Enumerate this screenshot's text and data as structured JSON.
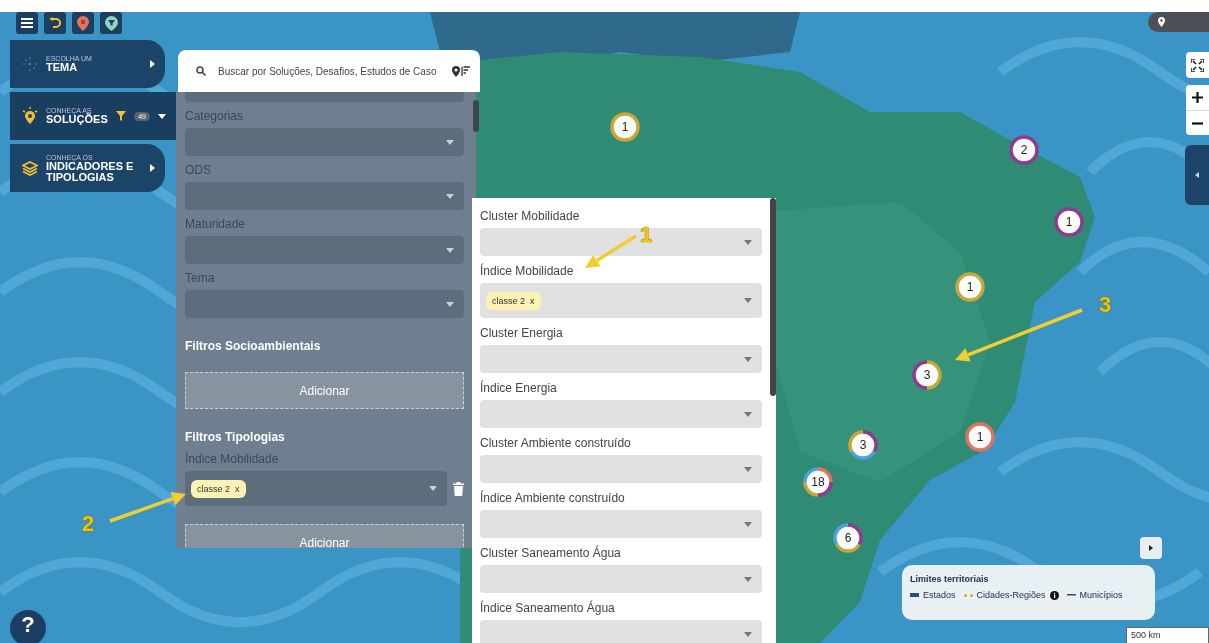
{
  "nav": [
    {
      "kicker": "ESCOLHA UM",
      "title": "TEMA",
      "selected": false
    },
    {
      "kicker": "CONHEÇA AS",
      "title": "SOLUÇÕES",
      "selected": true,
      "badge": "49"
    },
    {
      "kicker": "CONHEÇA OS",
      "title": "INDICADORES E TIPOLOGIAS",
      "selected": false
    }
  ],
  "search": {
    "placeholder": "Buscar por Soluções, Desafios, Estudos de Caso"
  },
  "filter_panel": {
    "fields": [
      {
        "kind": "stub"
      },
      {
        "kind": "select",
        "label": "Categorias"
      },
      {
        "kind": "select",
        "label": "ODS"
      },
      {
        "kind": "select",
        "label": "Maturidade"
      },
      {
        "kind": "select",
        "label": "Tema"
      }
    ],
    "sections": [
      {
        "heading": "Filtros Socioambientais",
        "button": "Adicionar"
      },
      {
        "heading": "Filtros Tipologias",
        "fields": [
          {
            "kind": "select",
            "label": "Índice Mobilidade",
            "chips": [
              {
                "label": "classe 2",
                "remove": "x"
              }
            ],
            "deletable": true
          }
        ],
        "button": "Adicionar"
      }
    ]
  },
  "options_panel": {
    "fields": [
      {
        "kind": "select",
        "label": "Cluster Mobilidade"
      },
      {
        "kind": "select",
        "label": "Índice Mobilidade",
        "chips": [
          {
            "label": "classe 2",
            "remove": "x"
          }
        ]
      },
      {
        "kind": "select",
        "label": "Cluster Energia"
      },
      {
        "kind": "select",
        "label": "Índice Energia"
      },
      {
        "kind": "select",
        "label": "Cluster Ambiente construído"
      },
      {
        "kind": "select",
        "label": "Índice Ambiente construído"
      },
      {
        "kind": "select",
        "label": "Cluster Saneamento Água"
      },
      {
        "kind": "select",
        "label": "Índice Saneamento Água"
      }
    ]
  },
  "markers": [
    {
      "count": "1",
      "segments": [
        {
          "color": "#c9a53a"
        }
      ]
    },
    {
      "count": "2",
      "segments": [
        {
          "color": "#8e3b8f"
        }
      ]
    },
    {
      "count": "1",
      "segments": [
        {
          "color": "#8e3b8f"
        }
      ]
    },
    {
      "count": "1",
      "segments": [
        {
          "color": "#c9a53a"
        }
      ]
    },
    {
      "count": "3",
      "segments": [
        {
          "color": "#c9a53a"
        },
        {
          "color": "#8e3b8f"
        }
      ]
    },
    {
      "count": "1",
      "segments": [
        {
          "color": "#e2735f"
        }
      ]
    },
    {
      "count": "3",
      "segments": [
        {
          "color": "#8e3b8f"
        },
        {
          "color": "#4aa3e0"
        },
        {
          "color": "#c9a53a"
        }
      ]
    },
    {
      "count": "18",
      "segments": [
        {
          "color": "#e2735f"
        },
        {
          "color": "#8e3b8f"
        },
        {
          "color": "#c9a53a"
        },
        {
          "color": "#4aa3e0"
        }
      ]
    },
    {
      "count": "6",
      "segments": [
        {
          "color": "#8e3b8f"
        },
        {
          "color": "#c9a53a"
        },
        {
          "color": "#4aa3e0"
        }
      ]
    }
  ],
  "annotations": [
    {
      "label": "1"
    },
    {
      "label": "2"
    },
    {
      "label": "3"
    }
  ],
  "legend": {
    "title": "Limites territoriais",
    "items": [
      {
        "kind": "line",
        "label": "Estados",
        "color": "#2b4c7e",
        "info": false
      },
      {
        "kind": "dots",
        "label": "Cidades-Regiões",
        "color": "#e0a526",
        "info": true
      },
      {
        "kind": "thin",
        "label": "Municípios",
        "color": "#3a4a5a",
        "info": false
      }
    ]
  },
  "scale": "500 km",
  "help": "?"
}
